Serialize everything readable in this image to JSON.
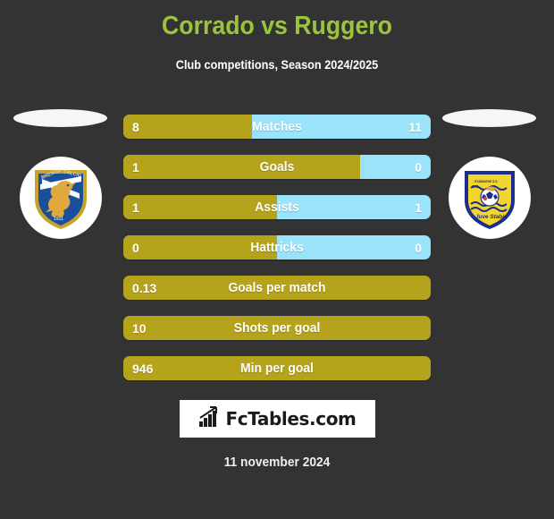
{
  "header": {
    "title": "Corrado vs Ruggero",
    "subtitle": "Club competitions, Season 2024/2025",
    "title_color": "#9CC33C",
    "subtitle_color": "#ffffff"
  },
  "theme": {
    "background": "#333333",
    "home_color": "#B5A41B",
    "away_color": "#9BE3FB",
    "badge_backdrop": "#ffffff"
  },
  "teams": {
    "home": {
      "name": "Brescia Calcio",
      "crest_text_top": "BRESCIA CALCIO",
      "crest_text_bottom": "1911",
      "crest_colors": {
        "shield": "#1B4F9C",
        "border": "#C9A227",
        "lion": "#E0A93B",
        "cross": "#ffffff"
      }
    },
    "away": {
      "name": "S.S. Juve Stabia",
      "crest_text_top": "STABIAESE S.S.",
      "crest_text_mid": "S.S.",
      "crest_text_bottom": "Juve Stabia",
      "crest_colors": {
        "shield": "#F2D62E",
        "border": "#1B2E8C",
        "waves": "#1B2E8C",
        "ball": "#ffffff"
      }
    }
  },
  "stats": [
    {
      "label": "Matches",
      "home": "8",
      "away": "11",
      "home_pct": 42,
      "split": true
    },
    {
      "label": "Goals",
      "home": "1",
      "away": "0",
      "home_pct": 77,
      "split": true
    },
    {
      "label": "Assists",
      "home": "1",
      "away": "1",
      "home_pct": 50,
      "split": true
    },
    {
      "label": "Hattricks",
      "home": "0",
      "away": "0",
      "home_pct": 50,
      "split": true
    },
    {
      "label": "Goals per match",
      "home": "0.13",
      "away": "",
      "home_pct": 100,
      "split": false
    },
    {
      "label": "Shots per goal",
      "home": "10",
      "away": "",
      "home_pct": 100,
      "split": false
    },
    {
      "label": "Min per goal",
      "home": "946",
      "away": "",
      "home_pct": 100,
      "split": false
    }
  ],
  "footer": {
    "logo_text": "FcTables.com",
    "logo_icon": "bar-chart-arrow-icon",
    "date": "11 november 2024"
  }
}
